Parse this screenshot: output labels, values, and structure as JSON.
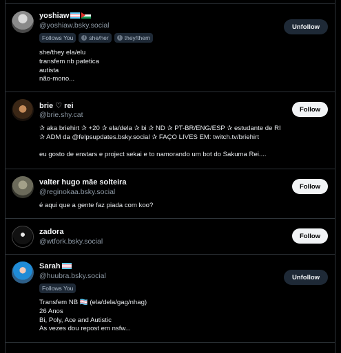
{
  "profiles": [
    {
      "name": "yoshiaw",
      "flags": [
        "trans-flag",
        "palestine-flag"
      ],
      "handle": "@yoshiaw.bsky.social",
      "badges": [
        "Follows You",
        "she/her",
        "they/them"
      ],
      "bio": "she/they ela/elu\ntransfem nb patetica\nautista\nnão-mono...",
      "button": "Unfollow"
    },
    {
      "name": "brie ♡ rei",
      "handle": "@brie.shy.cat",
      "bio": "✰ aka briehirt ✰ +20 ✰ ela/dela ✰ bi ✰ ND ✰ PT-BR/ENG/ESP ✰ estudante de RI\n✰ ADM da @felpsupdates.bsky.social ✰ FAÇO LIVES EM: twitch.tv/briehirt\n\neu gosto de enstars e project sekai e to namorando um bot do Sakuma Rei....",
      "button": "Follow"
    },
    {
      "name": "valter hugo mãe solteira",
      "handle": "@reginokaa.bsky.social",
      "bio": "é aqui que a gente faz piada com koo?",
      "button": "Follow"
    },
    {
      "name": "zadora",
      "handle": "@wtfork.bsky.social",
      "bio": "",
      "button": "Follow"
    },
    {
      "name": "Sarah",
      "flags": [
        "trans-flag"
      ],
      "handle": "@huubra.bsky.social",
      "badges": [
        "Follows You"
      ],
      "bio": "Transfem NB 🏳️‍⚧️ (ela/dela/gag/nhag)\n26 Anos\nBi, Poly, Ace and Autistic\nAs vezes dou repost em nsfw...",
      "button": "Unfollow"
    }
  ]
}
